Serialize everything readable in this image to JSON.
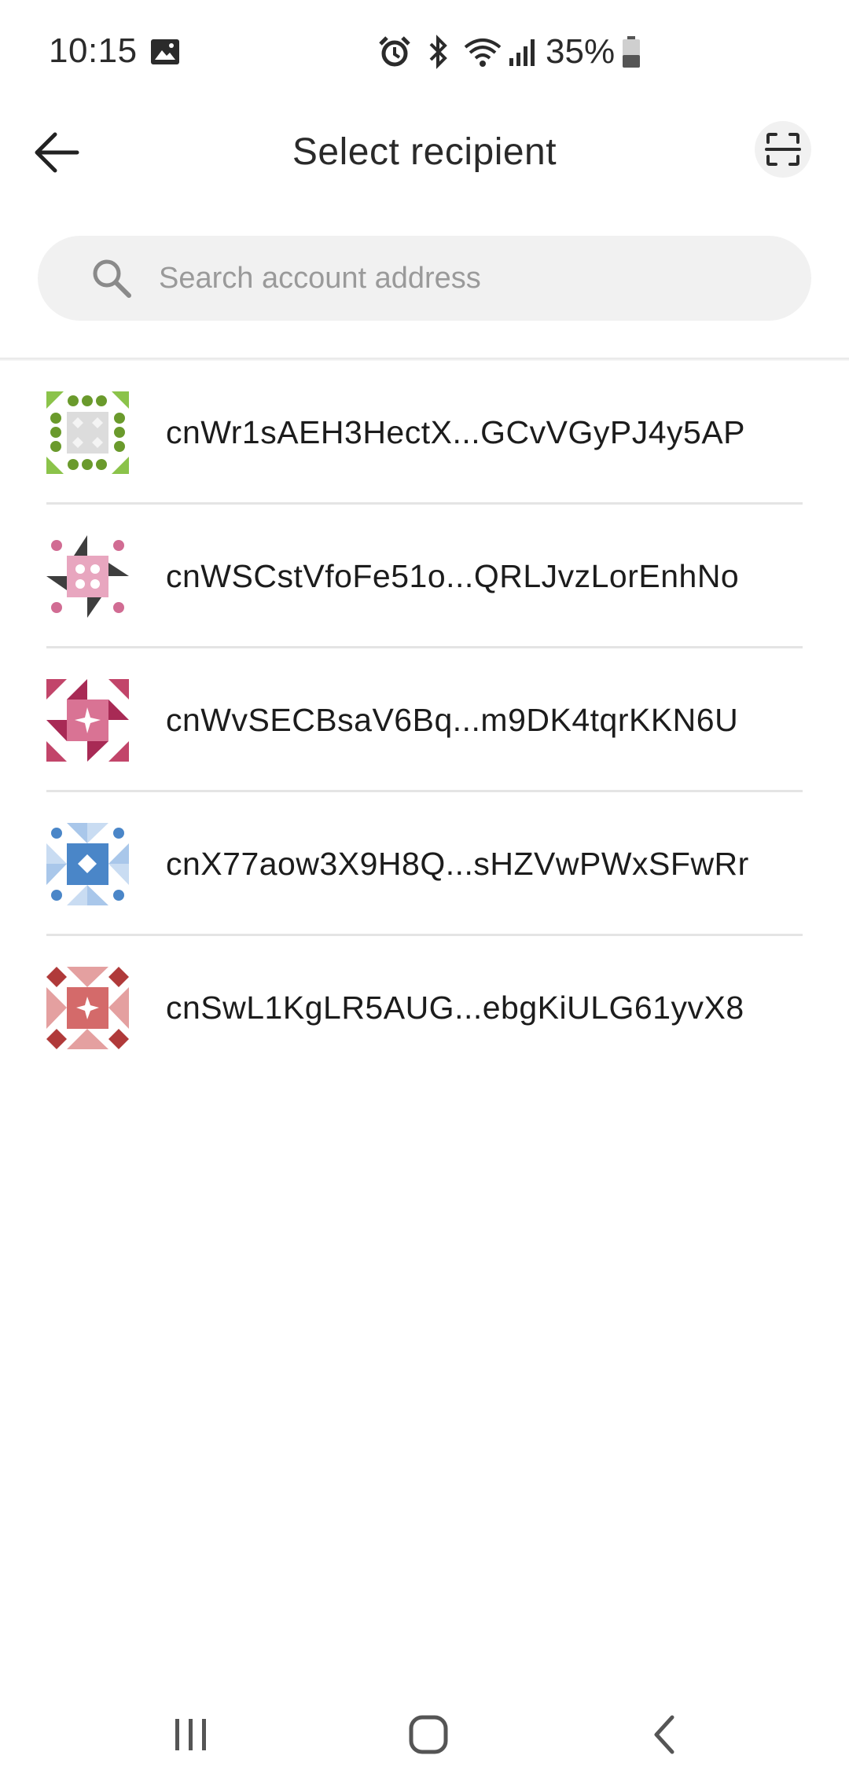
{
  "status_bar": {
    "time": "10:15",
    "battery": "35%",
    "icons": [
      "gallery-icon",
      "alarm-icon",
      "bluetooth-icon",
      "wifi-icon",
      "signal-icon",
      "battery-icon"
    ]
  },
  "header": {
    "title": "Select recipient",
    "back_icon": "arrow-left-icon",
    "scan_icon": "scan-qr-icon"
  },
  "search": {
    "placeholder": "Search account address",
    "value": ""
  },
  "recipients": [
    {
      "address": "cnWr1sAEH3HectX...GCvVGyPJ4y5AP",
      "avatar_color": "#7cb342"
    },
    {
      "address": "cnWSCstVfoFe51o...QRLJvzLorEnhNo",
      "avatar_color": "#d16c93"
    },
    {
      "address": "cnWvSECBsaV6Bq...m9DK4tqrKKN6U",
      "avatar_color": "#c2456a"
    },
    {
      "address": "cnX77aow3X9H8Q...sHZVwPWxSFwRr",
      "avatar_color": "#4a86c8"
    },
    {
      "address": "cnSwL1KgLR5AUG...ebgKiULG61yvX8",
      "avatar_color": "#c94a4a"
    }
  ],
  "nav_bar": {
    "items": [
      "recent-apps-icon",
      "home-icon",
      "back-icon"
    ]
  }
}
